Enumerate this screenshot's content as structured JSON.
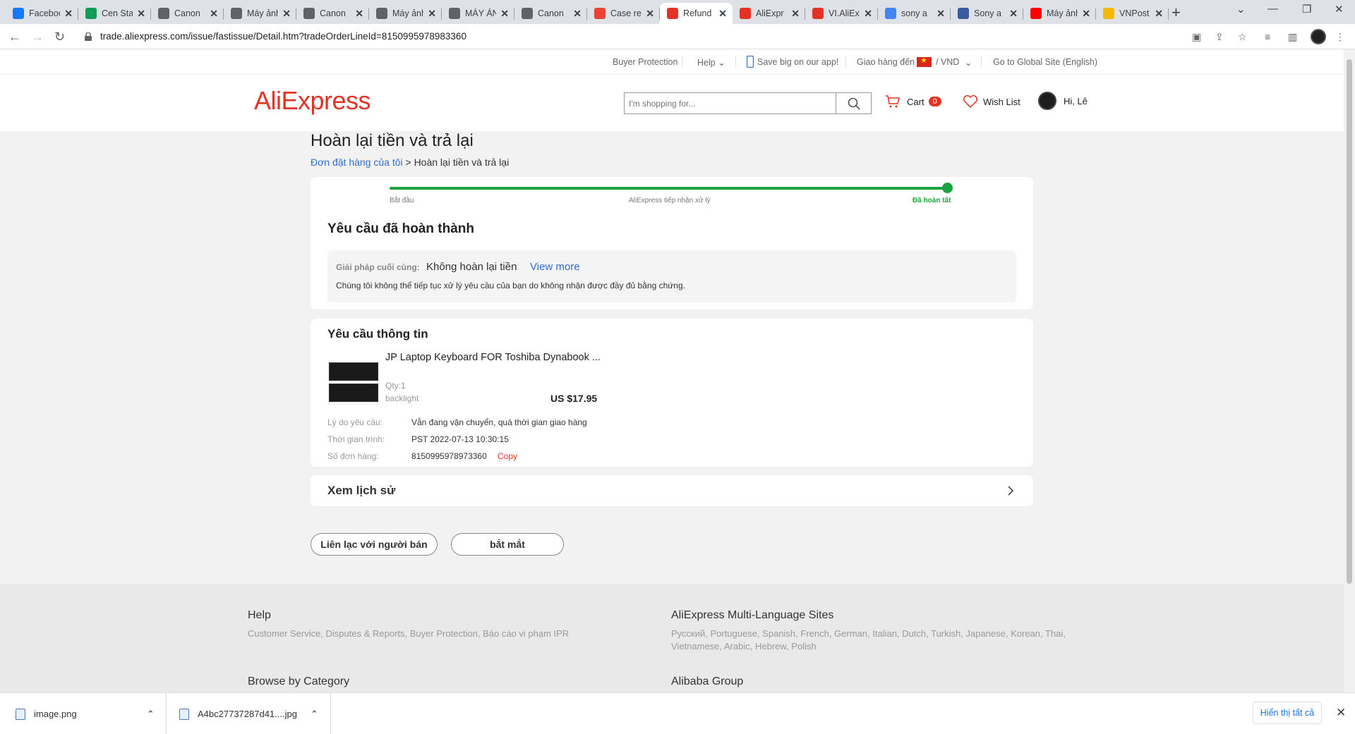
{
  "browser": {
    "tabs": [
      {
        "title": "Facebook",
        "favicon_color": "#1877f2",
        "icon": "facebook-icon"
      },
      {
        "title": "Cen Stats",
        "favicon_color": "#0f9d58",
        "icon": "sheets-icon"
      },
      {
        "title": "Canon",
        "favicon_color": "#5f6368",
        "icon": "globe-icon"
      },
      {
        "title": "Máy ảnh",
        "favicon_color": "#5f6368",
        "icon": "globe-icon"
      },
      {
        "title": "Canon",
        "favicon_color": "#5f6368",
        "icon": "globe-icon"
      },
      {
        "title": "Máy ảnh",
        "favicon_color": "#5f6368",
        "icon": "globe-icon"
      },
      {
        "title": "MÁY ẢNH",
        "favicon_color": "#5f6368",
        "icon": "camera-icon"
      },
      {
        "title": "Canon",
        "favicon_color": "#5f6368",
        "icon": "globe-icon"
      },
      {
        "title": "Case re",
        "favicon_color": "#ea4335",
        "icon": "gmail-icon"
      },
      {
        "title": "Refund",
        "favicon_color": "#e43225",
        "icon": "aliexpress-icon"
      },
      {
        "title": "AliExpr",
        "favicon_color": "#e43225",
        "icon": "aliexpress-icon"
      },
      {
        "title": "VI.AliEx",
        "favicon_color": "#e43225",
        "icon": "aliexpress-icon"
      },
      {
        "title": "sony a",
        "favicon_color": "#4285f4",
        "icon": "google-icon"
      },
      {
        "title": "Sony a",
        "favicon_color": "#3a5ba0",
        "icon": "globe-icon"
      },
      {
        "title": "Máy ảnh",
        "favicon_color": "#ff0000",
        "icon": "youtube-icon"
      },
      {
        "title": "VNPost",
        "favicon_color": "#f5b800",
        "icon": "vnpost-icon"
      }
    ],
    "active_tab_index": 9,
    "url": "trade.aliexpress.com/issue/fastissue/Detail.htm?tradeOrderLineId=8150995978983360"
  },
  "topnav": {
    "buyer_protection": "Buyer Protection",
    "help": "Help",
    "app": "Save big on our app!",
    "ship_to": "Giao hàng đến",
    "currency": "/ VND",
    "global_site": "Go to Global Site (English)"
  },
  "header": {
    "logo": "AliExpress",
    "search_placeholder": "I'm shopping for...",
    "cart_label": "Cart",
    "cart_count": "0",
    "wishlist_label": "Wish List",
    "user_greeting": "Hi, Lê"
  },
  "page": {
    "title": "Hoàn lại tiền và trả lại",
    "breadcrumb_link": "Đơn đặt hàng của tôi",
    "breadcrumb_current": " > Hoàn lại tiền và trả lại"
  },
  "status": {
    "steps": [
      "Bắt đầu",
      "AliExpress tiếp nhận xử lý",
      "Đã hoàn tất"
    ],
    "progress_fraction": 1.0,
    "heading": "Yêu cầu đã hoàn thành",
    "resolution_label": "Giải pháp cuối cùng:",
    "resolution_value": "Không hoàn lại tiền",
    "view_more": "View more",
    "note": "Chúng tôi không thể tiếp tục xử lý yêu cầu của bạn do không nhận được đầy đủ bằng chứng."
  },
  "request": {
    "heading": "Yêu cầu thông tin",
    "product_name": "JP Laptop Keyboard FOR Toshiba Dynabook ...",
    "qty": "Qty:1",
    "variant": "backlight",
    "price": "US $17.95",
    "fields": [
      {
        "label": "Lý do yêu cầu:",
        "value": "Vẫn đang vận chuyển, quá thời gian giao hàng"
      },
      {
        "label": "Thời gian trình:",
        "value": "PST 2022-07-13 10:30:15"
      },
      {
        "label": "Số đơn hàng:",
        "value": "8150995978973360"
      }
    ],
    "copy_label": "Copy"
  },
  "history": {
    "label": "Xem lịch sử"
  },
  "actions": {
    "contact_seller": "Liên lạc với người bán",
    "report": "bắt mắt"
  },
  "footer": {
    "help_heading": "Help",
    "help_links": "Customer Service, Disputes & Reports, Buyer Protection, Báo cáo vi phạm IPR",
    "multilang_heading": "AliExpress Multi-Language Sites",
    "multilang_links": "Русский, Portuguese, Spanish, French, German, Italian, Dutch, Turkish, Japanese, Korean, Thai, Vietnamese, Arabic, Hebrew, Polish",
    "browse_heading": "Browse by Category",
    "alibaba_heading": "Alibaba Group"
  },
  "downloads": {
    "items": [
      "image.png",
      "A4bc27737287d41....jpg"
    ],
    "show_all": "Hiển thị tất cả"
  },
  "colors": {
    "brand": "#e43225",
    "link": "#2e6fd1",
    "progress": "#19a23f"
  }
}
